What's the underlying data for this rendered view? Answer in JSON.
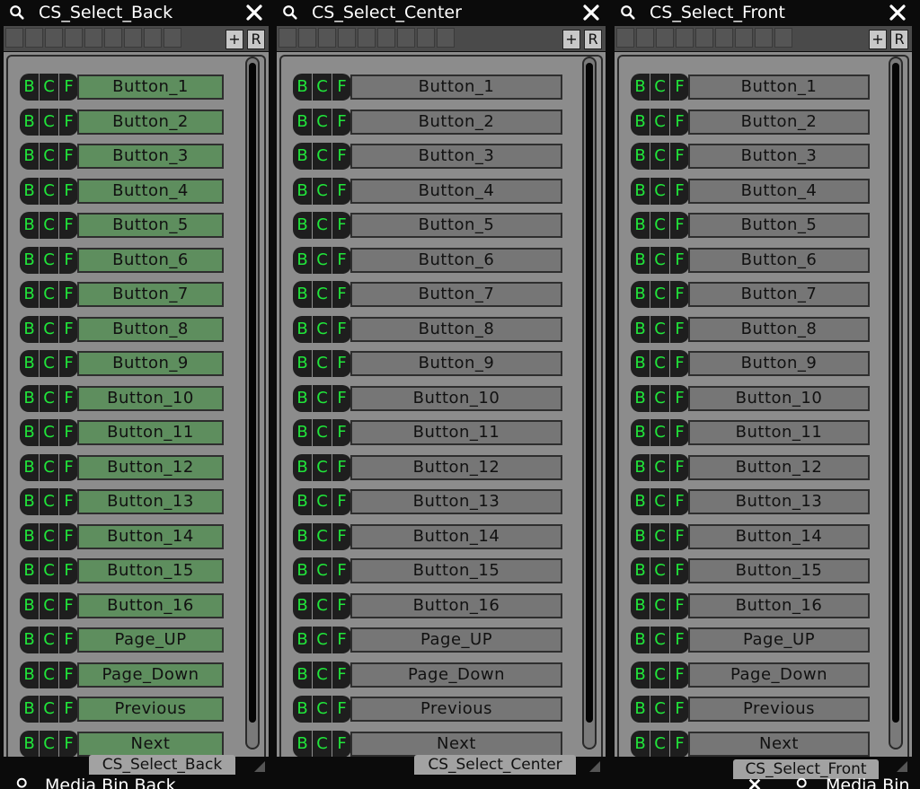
{
  "buttons": [
    "Button_1",
    "Button_2",
    "Button_3",
    "Button_4",
    "Button_5",
    "Button_6",
    "Button_7",
    "Button_8",
    "Button_9",
    "Button_10",
    "Button_11",
    "Button_12",
    "Button_13",
    "Button_14",
    "Button_15",
    "Button_16",
    "Page_UP",
    "Page_Down",
    "Previous",
    "Next"
  ],
  "bcf": [
    "B",
    "C",
    "F"
  ],
  "panels": [
    {
      "title": "CS_Select_Back",
      "footer": "CS_Select_Back",
      "theme": "green"
    },
    {
      "title": "CS_Select_Center",
      "footer": "CS_Select_Center",
      "theme": "gray"
    },
    {
      "title": "CS_Select_Front",
      "footer": "CS_Select_Front",
      "theme": "gray"
    }
  ],
  "toolbar": {
    "add_label": "+",
    "r_label": "R"
  },
  "bottom": {
    "left_title": "Media Bin Back",
    "right_title": "Media Bin"
  },
  "colors": {
    "bcf_text": "#20e63a",
    "button_green": "#5e8e5e",
    "button_gray": "#767676",
    "panel_bg": "#8c8c8c"
  }
}
